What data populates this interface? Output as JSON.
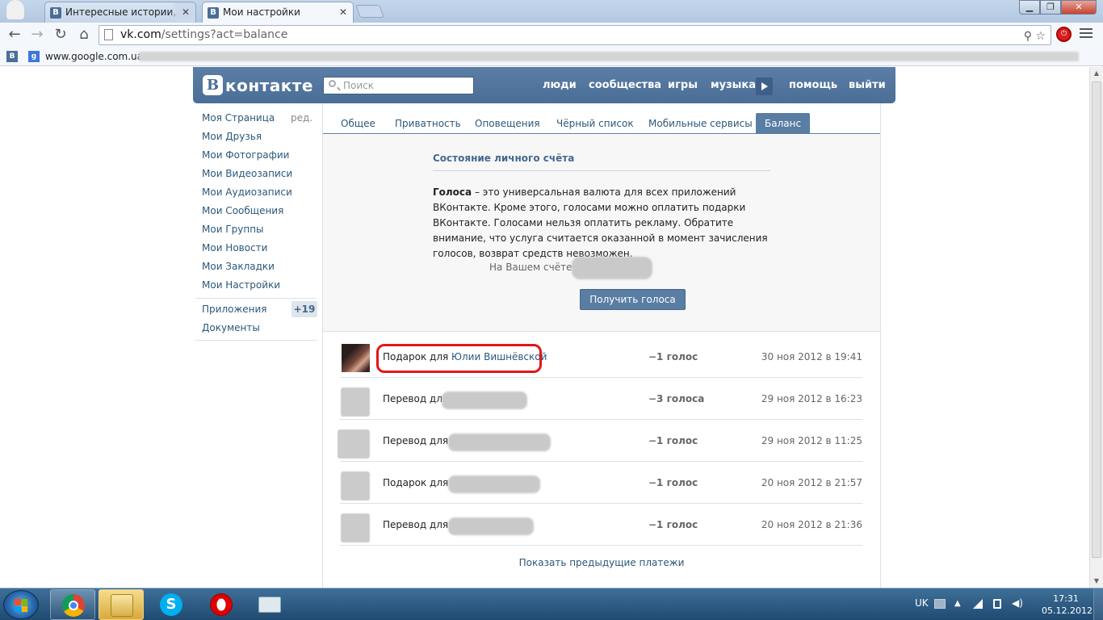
{
  "browser": {
    "tabs": [
      {
        "label": "Интересные истории, см",
        "favicon": "В",
        "active": false
      },
      {
        "label": "Мои настройки",
        "favicon": "В",
        "active": true
      }
    ],
    "url_host": "vk.com",
    "url_path": "/settings?act=balance",
    "bookmarks": [
      {
        "icon": "vk-icon",
        "label": ""
      },
      {
        "icon": "google-icon",
        "label": "www.google.com.ua"
      }
    ]
  },
  "vk": {
    "logo_letter": "В",
    "logo_text": "контакте",
    "search_placeholder": "Поиск",
    "nav": [
      "люди",
      "сообщества",
      "игры",
      "музыка",
      "помощь",
      "выйти"
    ],
    "sidebar": [
      "Моя Страница",
      "Мои Друзья",
      "Мои Фотографии",
      "Мои Видеозаписи",
      "Мои Аудиозаписи",
      "Мои Сообщения",
      "Мои Группы",
      "Мои Новости",
      "Мои Закладки",
      "Мои Настройки"
    ],
    "sidebar_edit": "ред.",
    "sidebar_apps": "Приложения",
    "sidebar_apps_badge": "+19",
    "sidebar_docs": "Документы",
    "settings_tabs": [
      "Общее",
      "Приватность",
      "Оповещения",
      "Чёрный список",
      "Мобильные сервисы",
      "Баланс"
    ],
    "balance": {
      "title": "Состояние личного счёта",
      "text_bold": "Голоса",
      "text_rest": " – это универсальная валюта для всех приложений ВКонтакте. Кроме этого, голосами можно оплатить подарки ВКонтакте. Голосами нельзя оплатить рекламу. Обратите внимание, что услуга считается оказанной в момент зачисления голосов, возврат средств невозможен.",
      "account_label": "На Вашем счёте:",
      "button": "Получить голоса"
    },
    "payments": [
      {
        "desc": "Подарок для ",
        "name": "Юлии Вишнёвской",
        "amount": "−1 голос",
        "date": "30 ноя 2012 в 19:41"
      },
      {
        "desc": "Перевод для",
        "name": "",
        "amount": "−3 голоса",
        "date": "29 ноя 2012 в 16:23"
      },
      {
        "desc": "Перевод для I",
        "name": "",
        "amount": "−1 голос",
        "date": "29 ноя 2012 в 11:25"
      },
      {
        "desc": "Подарок для Y",
        "name": "",
        "amount": "−1 голос",
        "date": "20 ноя 2012 в 21:57"
      },
      {
        "desc": "Перевод для Y",
        "name": "",
        "amount": "−1 голос",
        "date": "20 ноя 2012 в 21:36"
      }
    ],
    "more_payments": "Показать предыдущие платежи"
  },
  "taskbar": {
    "apps": [
      "chrome-icon",
      "explorer-icon",
      "skype-icon",
      "opera-icon",
      "keyboard-icon"
    ],
    "lang": "UK",
    "time": "17:31",
    "date": "05.12.2012"
  },
  "colors": {
    "vk_blue": "#597da3",
    "link": "#2b587a",
    "highlight": "#e11717"
  }
}
